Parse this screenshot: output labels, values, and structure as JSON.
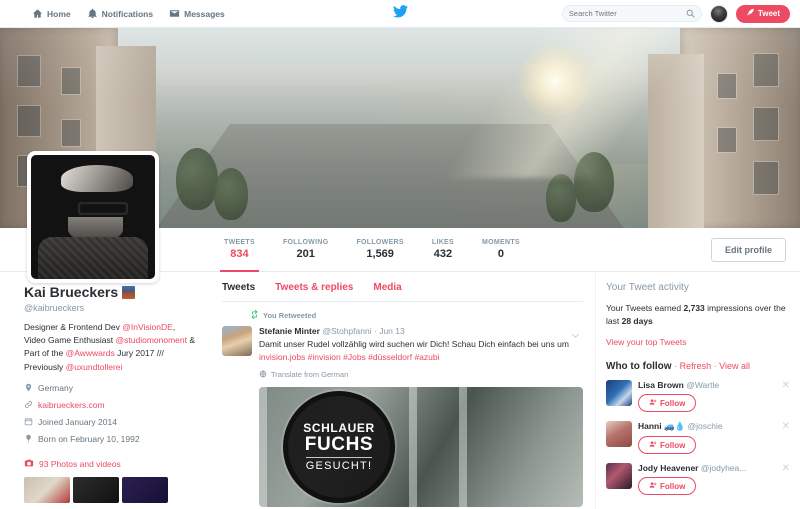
{
  "nav": {
    "home": "Home",
    "notifications": "Notifications",
    "messages": "Messages",
    "search_placeholder": "Search Twitter",
    "tweet_button": "Tweet",
    "accent": "#ed4a63"
  },
  "profile": {
    "name": "Kai Brueckers",
    "handle": "@kaibrueckers",
    "bio_line1_a": "Designer & Frontend Dev ",
    "bio_mention1": "@InVisionDE",
    "bio_line1_b": ", Video Game Enthusiast ",
    "bio_mention2": "@studiomonoment",
    "bio_line2": " & Part of the ",
    "bio_mention3": "@Awwwards",
    "bio_line3": " Jury 2017 /// Previously ",
    "bio_mention4": "@uxundtollerei",
    "location": "Germany",
    "website": "kaibrueckers.com",
    "joined": "Joined January 2014",
    "birthday": "Born on February 10, 1992",
    "photos_videos": "93 Photos and videos",
    "edit_profile": "Edit profile"
  },
  "stats": [
    {
      "label": "TWEETS",
      "value": "834",
      "active": true
    },
    {
      "label": "FOLLOWING",
      "value": "201",
      "active": false
    },
    {
      "label": "FOLLOWERS",
      "value": "1,569",
      "active": false
    },
    {
      "label": "LIKES",
      "value": "432",
      "active": false
    },
    {
      "label": "MOMENTS",
      "value": "0",
      "active": false
    }
  ],
  "tabs": [
    {
      "label": "Tweets",
      "active": true
    },
    {
      "label": "Tweets & replies",
      "active": false
    },
    {
      "label": "Media",
      "active": false
    }
  ],
  "tweet": {
    "retweet_label": "You Retweeted",
    "author_name": "Stefanie Minter",
    "author_handle": "@Stohpfanni",
    "separator": "·",
    "time": "Jun 13",
    "text": "Damit unser Rudel vollzählig wird suchen wir Dich! Schau Dich einfach bei uns um ",
    "link": "invision.jobs",
    "hashtags": " #invision #Jobs #düsseldorf #azubi",
    "translate": "Translate from German",
    "media_line1": "SCHLAUER",
    "media_line2": "FUCHS",
    "media_line3": "GESUCHT!"
  },
  "activity": {
    "title": "Your Tweet activity",
    "text_a": "Your Tweets earned ",
    "impressions": "2,733",
    "text_b": " impressions over the last ",
    "days": "28 days",
    "link": "View your top Tweets"
  },
  "who_to_follow": {
    "title": "Who to follow",
    "sep1": "·",
    "refresh": "Refresh",
    "sep2": "·",
    "view_all": "View all",
    "follow_label": "Follow",
    "suggestions": [
      {
        "name": "Lisa Brown",
        "handle": "@Wartle"
      },
      {
        "name": "Hanni 🚙💧",
        "handle": "@joschie"
      },
      {
        "name": "Jody Heavener",
        "handle": "@jodyhea..."
      }
    ]
  }
}
